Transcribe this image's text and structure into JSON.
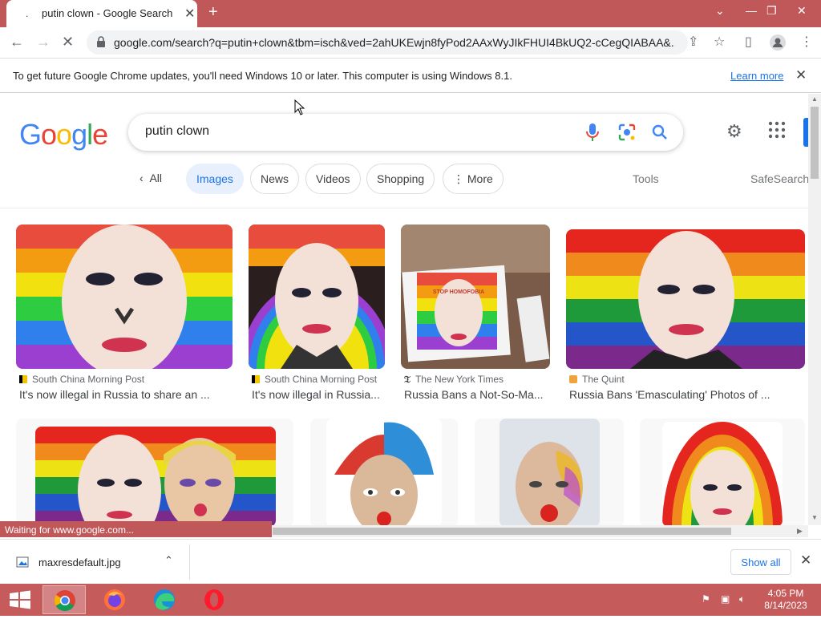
{
  "browser": {
    "tab_title": "putin clown - Google Search",
    "tab_favicon": ".",
    "url": "google.com/search?q=putin+clown&tbm=isch&ved=2ahUKEwjn8fyPod2AAxWyJIkFHUI4BkUQ2-cCegQIABAA&...",
    "status_text": "Waiting for www.google.com..."
  },
  "infobar": {
    "message": "To get future Google Chrome updates, you'll need Windows 10 or later. This computer is using Windows 8.1.",
    "link": "Learn more"
  },
  "search": {
    "logo": "Google",
    "query": "putin clown"
  },
  "filters": {
    "all": "All",
    "images": "Images",
    "news": "News",
    "videos": "Videos",
    "shopping": "Shopping",
    "more": "More",
    "tools": "Tools",
    "safesearch": "SafeSearch"
  },
  "results": [
    {
      "source": "South China Morning Post",
      "title": "It's now illegal in Russia to share an ..."
    },
    {
      "source": "South China Morning Post",
      "title": "It's now illegal in Russia..."
    },
    {
      "source": "The New York Times",
      "title": "Russia Bans a Not-So-Ma..."
    },
    {
      "source": "The Quint",
      "title": "Russia Bans 'Emasculating' Photos of ..."
    }
  ],
  "thumb_text": {
    "poster": "STOP HOMOFOBIA"
  },
  "download": {
    "file": "maxresdefault.jpg",
    "show_all": "Show all"
  },
  "taskbar": {
    "time": "4:05 PM",
    "date": "8/14/2023"
  },
  "colors": {
    "chrome_frame": "#c0585a",
    "taskbar": "#c65b5c",
    "link_blue": "#1a73e8",
    "chip_active_bg": "#e8f0fe"
  }
}
